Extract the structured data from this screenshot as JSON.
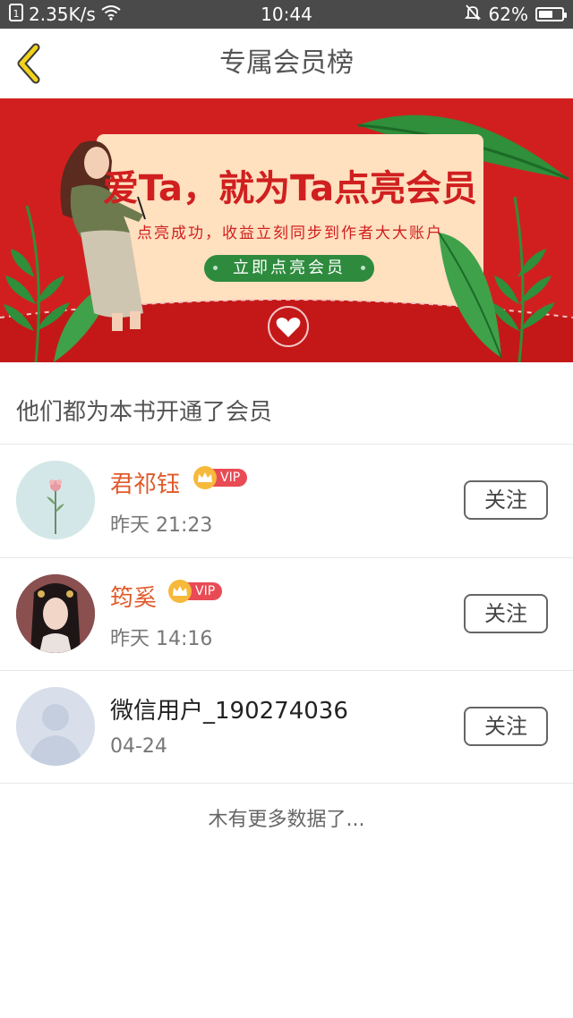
{
  "status_bar": {
    "speed": "2.35K/s",
    "time": "10:44",
    "battery": "62%",
    "battery_level": 0.62
  },
  "header": {
    "title": "专属会员榜"
  },
  "banner": {
    "headline": "爱Ta，就为Ta点亮会员",
    "subtitle": "点亮成功，收益立刻同步到作者大大账户",
    "button_label": "立即点亮会员"
  },
  "section": {
    "title": "他们都为本书开通了会员"
  },
  "members": [
    {
      "name": "君祁钰",
      "time": "昨天 21:23",
      "vip": true,
      "vip_label": "VIP",
      "follow_label": "关注"
    },
    {
      "name": "筠奚",
      "time": "昨天 14:16",
      "vip": true,
      "vip_label": "VIP",
      "follow_label": "关注"
    },
    {
      "name": "微信用户_190274036",
      "time": "04-24",
      "vip": false,
      "follow_label": "关注"
    }
  ],
  "footer": {
    "note": "木有更多数据了..."
  },
  "colors": {
    "banner_red": "#d11f1f",
    "vip_name": "#e05a2b",
    "vip_badge": "#e94b55",
    "crown": "#f6b93b",
    "banner_button": "#2e8b3e"
  }
}
